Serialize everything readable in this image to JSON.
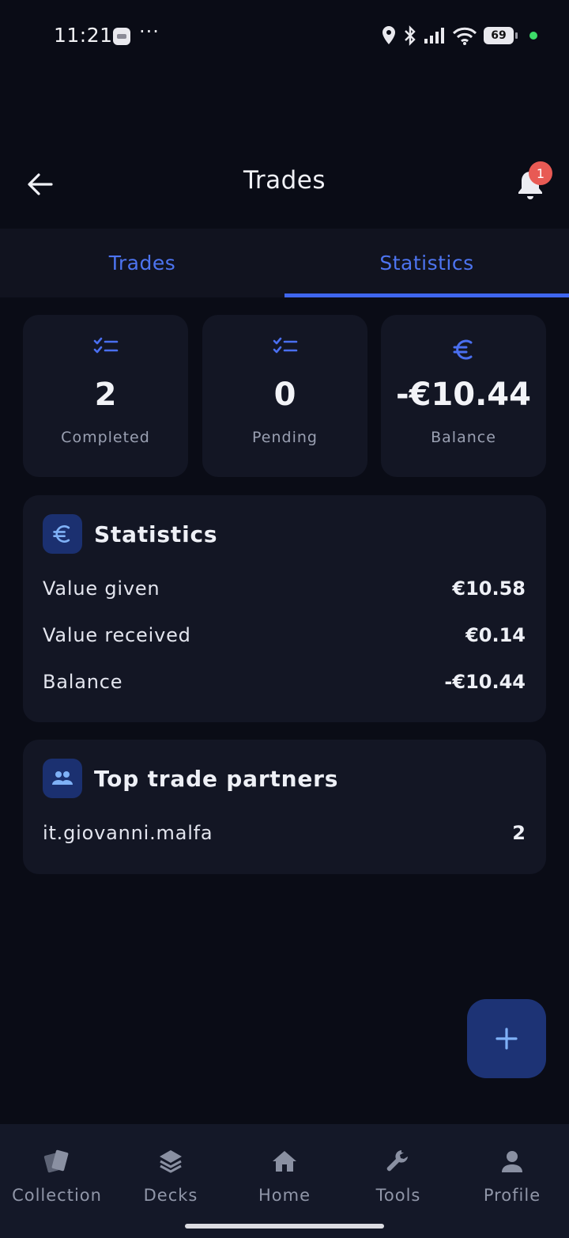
{
  "status_bar": {
    "time": "11:21",
    "dots": "···",
    "battery": "69",
    "icons": [
      "location-icon",
      "bluetooth-icon",
      "signal-icon",
      "wifi-icon",
      "battery-icon"
    ]
  },
  "header": {
    "title": "Trades",
    "notification_count": "1"
  },
  "tabs": [
    {
      "label": "Trades",
      "active": false
    },
    {
      "label": "Statistics",
      "active": true
    }
  ],
  "stats": [
    {
      "value": "2",
      "label": "Completed",
      "icon": "checklist-icon"
    },
    {
      "value": "0",
      "label": "Pending",
      "icon": "checklist-icon"
    },
    {
      "value": "-€10.44",
      "label": "Balance",
      "icon": "euro-icon"
    }
  ],
  "statistics_panel": {
    "title": "Statistics",
    "rows": [
      {
        "label": "Value given",
        "value": "€10.58"
      },
      {
        "label": "Value received",
        "value": "€0.14"
      },
      {
        "label": "Balance",
        "value": "-€10.44"
      }
    ]
  },
  "partners_panel": {
    "title": "Top trade partners",
    "rows": [
      {
        "label": "it.giovanni.malfa",
        "value": "2"
      }
    ]
  },
  "bottom_nav": [
    {
      "label": "Collection",
      "icon": "cards-icon"
    },
    {
      "label": "Decks",
      "icon": "layers-icon"
    },
    {
      "label": "Home",
      "icon": "home-icon"
    },
    {
      "label": "Tools",
      "icon": "wrench-icon"
    },
    {
      "label": "Profile",
      "icon": "person-icon"
    }
  ],
  "colors": {
    "accent": "#3f66ee",
    "background": "#0a0c16",
    "card": "#131624",
    "badge": "#e85a54"
  }
}
